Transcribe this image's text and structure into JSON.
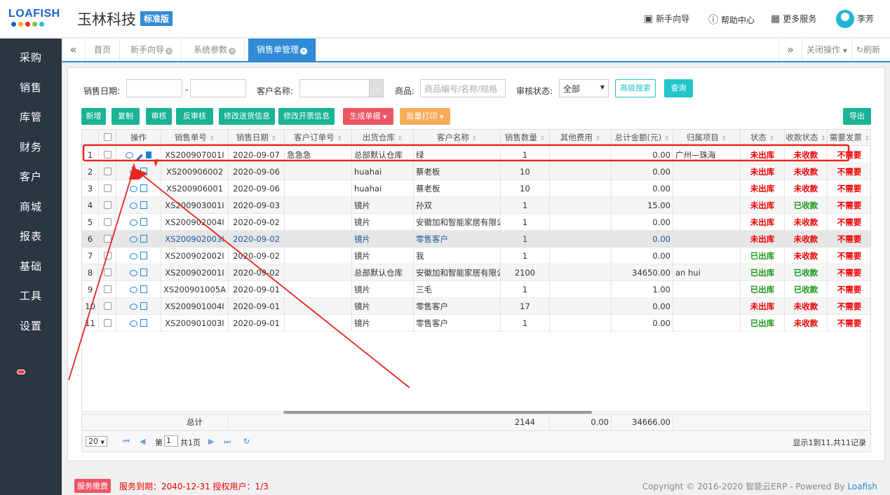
{
  "header": {
    "logo_text": "LOAFISH",
    "app_title": "玉林科技",
    "edition": "标准版",
    "nav": [
      {
        "label": "新手向导",
        "icon": "guide-icon"
      },
      {
        "label": "帮助中心",
        "icon": "help-icon"
      },
      {
        "label": "更多服务",
        "icon": "grid-icon"
      }
    ],
    "user": "李芳"
  },
  "sidebar": {
    "items": [
      "采购",
      "销售",
      "库管",
      "财务",
      "客户",
      "商城",
      "报表",
      "基础",
      "工具",
      "设置"
    ]
  },
  "tabs": {
    "items": [
      {
        "label": "首页",
        "closable": false
      },
      {
        "label": "新手向导",
        "closable": true
      },
      {
        "label": "系统参数",
        "closable": true
      },
      {
        "label": "销售单管理",
        "closable": true,
        "active": true
      }
    ],
    "close_ops": "关闭操作",
    "refresh": "刷新"
  },
  "filters": {
    "date_label": "销售日期:",
    "date_sep": "-",
    "customer_label": "客户名称:",
    "goods_label": "商品:",
    "goods_placeholder": "商品编号/名称/规格",
    "audit_label": "审核状态:",
    "audit_value": "全部",
    "advanced": "高级搜索",
    "query": "查询"
  },
  "toolbar": {
    "new": "新增",
    "copy": "复制",
    "audit": "审核",
    "unaudit": "反审核",
    "edit_delivery": "修改送货信息",
    "edit_invoice": "修改开票信息",
    "generate": "生成单据",
    "batch_print": "批量打印",
    "export": "导出"
  },
  "table": {
    "headers": [
      "操作",
      "销售单号",
      "销售日期",
      "客户订单号",
      "出货仓库",
      "客户名称",
      "销售数量",
      "其他费用",
      "总计金额(元)",
      "归属项目",
      "状态",
      "收款状态",
      "需要发票"
    ],
    "rows": [
      {
        "no": "1",
        "id": "XS200907001I",
        "date": "2020-09-07",
        "order": "急急急",
        "wh": "总部默认仓库",
        "cust": "绿",
        "qty": "1",
        "other": "",
        "total": "0.00",
        "proj": "广州—珠海",
        "status": "未出库",
        "pay": "未收款",
        "inv": "不需要"
      },
      {
        "no": "2",
        "id": "XS200906002",
        "date": "2020-09-06",
        "order": "",
        "wh": "huahai",
        "cust": "蔡老板",
        "qty": "10",
        "other": "",
        "total": "0.00",
        "proj": "",
        "status": "未出库",
        "pay": "未收款",
        "inv": "不需要"
      },
      {
        "no": "3",
        "id": "XS200906001",
        "date": "2020-09-06",
        "order": "",
        "wh": "huahai",
        "cust": "蔡老板",
        "qty": "10",
        "other": "",
        "total": "0.00",
        "proj": "",
        "status": "未出库",
        "pay": "未收款",
        "inv": "不需要"
      },
      {
        "no": "4",
        "id": "XS200903001I",
        "date": "2020-09-03",
        "order": "",
        "wh": "镜片",
        "cust": "孙双",
        "qty": "1",
        "other": "",
        "total": "15.00",
        "proj": "",
        "status": "未出库",
        "pay": "已收款",
        "inv": "不需要"
      },
      {
        "no": "5",
        "id": "XS200902004I",
        "date": "2020-09-02",
        "order": "",
        "wh": "镜片",
        "cust": "安徽加和智能家居有限公司",
        "qty": "1",
        "other": "",
        "total": "0.00",
        "proj": "",
        "status": "未出库",
        "pay": "未收款",
        "inv": "不需要"
      },
      {
        "no": "6",
        "id": "XS200902003I",
        "date": "2020-09-02",
        "order": "",
        "wh": "镜片",
        "cust": "零售客户",
        "qty": "1",
        "other": "",
        "total": "0.00",
        "proj": "",
        "status": "未出库",
        "pay": "未收款",
        "inv": "不需要"
      },
      {
        "no": "7",
        "id": "XS200902002I",
        "date": "2020-09-02",
        "order": "",
        "wh": "镜片",
        "cust": "我",
        "qty": "1",
        "other": "",
        "total": "0.00",
        "proj": "",
        "status": "已出库",
        "pay": "未收款",
        "inv": "不需要"
      },
      {
        "no": "8",
        "id": "XS200902001I",
        "date": "2020-09-02",
        "order": "",
        "wh": "总部默认仓库",
        "cust": "安徽加和智能家居有限公司",
        "qty": "2100",
        "other": "",
        "total": "34650.00",
        "proj": "an hui",
        "status": "已出库",
        "pay": "已收款",
        "inv": "不需要"
      },
      {
        "no": "9",
        "id": "XS200901005A",
        "date": "2020-09-01",
        "order": "",
        "wh": "镜片",
        "cust": "三毛",
        "qty": "1",
        "other": "",
        "total": "1.00",
        "proj": "",
        "status": "已出库",
        "pay": "已收款",
        "inv": "不需要"
      },
      {
        "no": "10",
        "id": "XS200901004I",
        "date": "2020-09-01",
        "order": "",
        "wh": "镜片",
        "cust": "零售客户",
        "qty": "17",
        "other": "",
        "total": "0.00",
        "proj": "",
        "status": "未出库",
        "pay": "未收款",
        "inv": "不需要"
      },
      {
        "no": "11",
        "id": "XS200901003I",
        "date": "2020-09-01",
        "order": "",
        "wh": "镜片",
        "cust": "零售客户",
        "qty": "1",
        "other": "",
        "total": "0.00",
        "proj": "",
        "status": "已出库",
        "pay": "未收款",
        "inv": "不需要"
      }
    ],
    "summary": {
      "label": "总计",
      "qty": "2144",
      "other": "0.00",
      "total": "34666.00"
    }
  },
  "pager": {
    "page_size": "20",
    "page_label_pre": "第",
    "page_value": "1",
    "page_label_post": "共1页",
    "info": "显示1到11,共11记录"
  },
  "footer": {
    "service_button": "服务缴费",
    "service_info": "服务到期：2040-12-31   授权用户：1/3",
    "copyright": "Copyright © 2016-2020 智能云ERP - Powered By ",
    "brand": "Loafish"
  },
  "colors": {
    "sidebar_bg": "#2b3643",
    "accent": "#2f8bd6",
    "teal_button": "#1ab394",
    "red_button": "#ed5565",
    "orange_button": "#f8ac59",
    "status_red": "#ee0000",
    "status_green": "#1a9a1a",
    "annotation": "#e8261f"
  }
}
